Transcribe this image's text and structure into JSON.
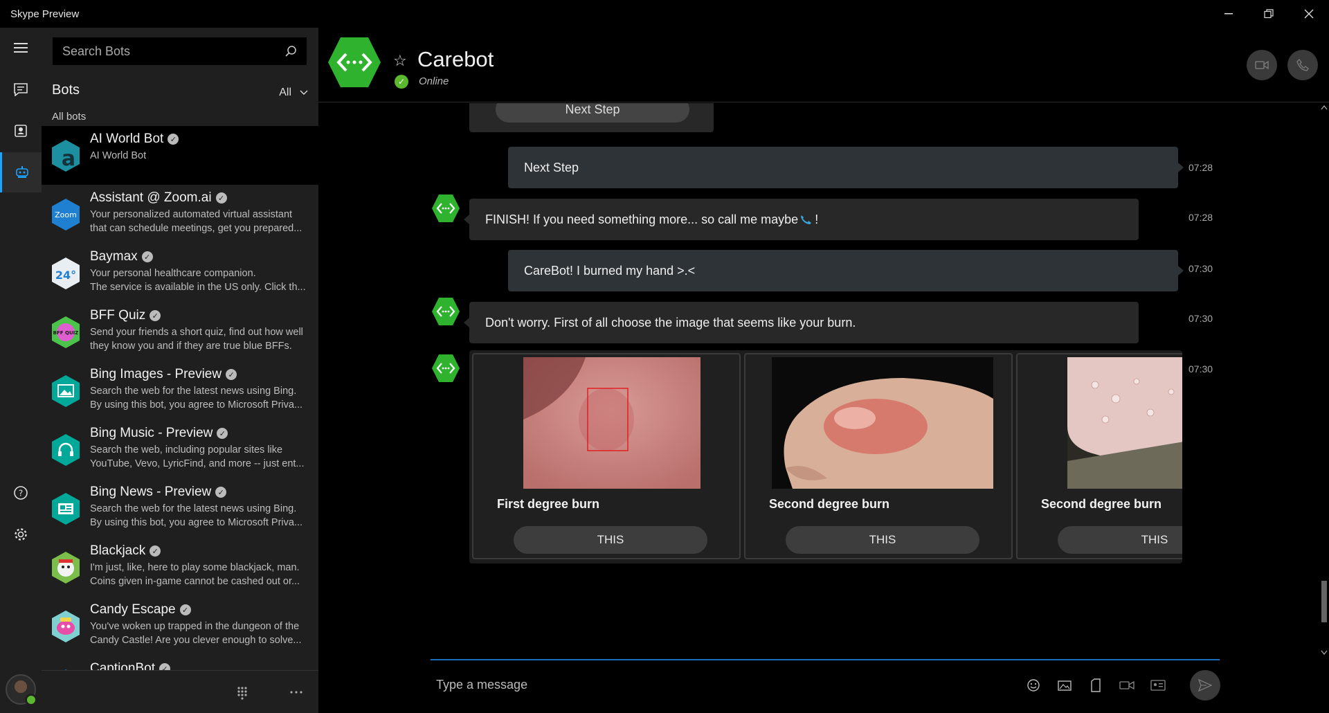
{
  "window": {
    "title": "Skype Preview"
  },
  "sidebar": {
    "search_placeholder": "Search Bots",
    "heading": "Bots",
    "filter": "All",
    "subheading": "All bots",
    "bots": [
      {
        "name": "AI World Bot",
        "desc1": "AI World Bot",
        "desc2": ""
      },
      {
        "name": "Assistant @ Zoom.ai",
        "desc1": "Your personalized automated virtual assistant",
        "desc2": "that can schedule meetings, get you prepared..."
      },
      {
        "name": "Baymax",
        "desc1": "Your personal healthcare companion.",
        "desc2": "The service is available in the US only. Click th..."
      },
      {
        "name": "BFF Quiz",
        "desc1": "Send your friends a short quiz, find out how well",
        "desc2": "they know you and if they are true blue BFFs."
      },
      {
        "name": "Bing Images - Preview",
        "desc1": "Search the web for the latest news using Bing.",
        "desc2": "By using this bot, you agree to Microsoft Priva..."
      },
      {
        "name": "Bing Music - Preview",
        "desc1": "Search the web, including popular sites like",
        "desc2": "YouTube, Vevo, LyricFind, and more -- just ent..."
      },
      {
        "name": "Bing News - Preview",
        "desc1": "Search the web for the latest news using Bing.",
        "desc2": "By using this bot, you agree to Microsoft Priva..."
      },
      {
        "name": "Blackjack",
        "desc1": "I'm just, like, here to play some blackjack, man.",
        "desc2": "Coins given in-game cannot be cashed out or..."
      },
      {
        "name": "Candy Escape",
        "desc1": "You've woken up trapped in the dungeon of the",
        "desc2": "Candy Castle! Are you clever enough to solve..."
      },
      {
        "name": "CaptionBot",
        "desc1": "",
        "desc2": ""
      }
    ],
    "zoom_logo_text": "Zoom",
    "baymax_logo_text": "24°",
    "bff_logo_text": "BFF QUIZ"
  },
  "chat": {
    "contact_name": "Carebot",
    "status": "Online",
    "prev_button": "Next Step",
    "messages": [
      {
        "dir": "out",
        "text": "Next Step",
        "time": "07:28"
      },
      {
        "dir": "in",
        "text": "FINISH! If you need something more... so call me maybe",
        "suffix": " !",
        "time": "07:28"
      },
      {
        "dir": "out",
        "text": "CareBot! I burned my hand >.<",
        "time": "07:30"
      },
      {
        "dir": "in",
        "text": "Don't worry. First of all choose the image that seems like your burn.",
        "time": "07:30"
      }
    ],
    "cards_time": "07:30",
    "cards": [
      {
        "title": "First degree burn",
        "button": "THIS"
      },
      {
        "title": "Second degree burn",
        "button": "THIS"
      },
      {
        "title": "Second degree burn",
        "button": "THIS"
      }
    ],
    "composer_placeholder": "Type a message"
  },
  "colors": {
    "accent": "#1aa3ff",
    "bot_green": "#2fb32f",
    "online": "#5cb82f"
  }
}
